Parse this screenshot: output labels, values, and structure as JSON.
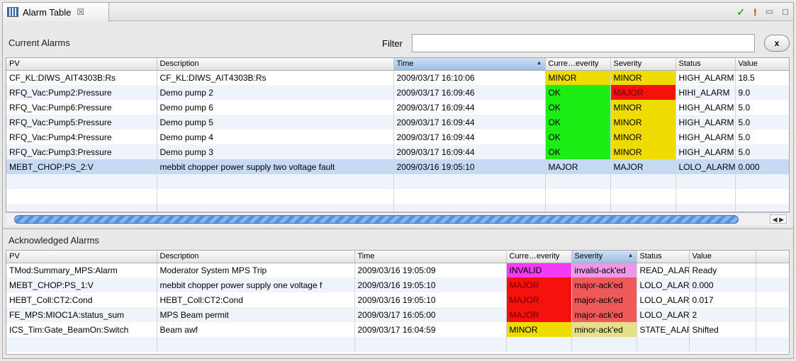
{
  "tab": {
    "title": "Alarm Table",
    "close": "☒"
  },
  "view_tools": {
    "check": "✓",
    "alert": "!",
    "minimize": "▭",
    "maximize": "◻"
  },
  "current": {
    "title": "Current Alarms",
    "filter_label": "Filter",
    "filter_value": "",
    "clear_label": "x",
    "columns": [
      "PV",
      "Description",
      "Time",
      "Curre…everity",
      "Severity",
      "Status",
      "Value"
    ],
    "sorted_column": "Time",
    "rows": [
      {
        "pv": "CF_KL:DIWS_AIT4303B:Rs",
        "description": "CF_KL:DIWS_AIT4303B:Rs",
        "time": "2009/03/17 16:10:06",
        "current_severity": "MINOR",
        "severity": "MINOR",
        "status": "HIGH_ALARM",
        "value": "18.5"
      },
      {
        "pv": "RFQ_Vac:Pump2:Pressure",
        "description": "Demo pump 2",
        "time": "2009/03/17 16:09:46",
        "current_severity": "OK",
        "severity": "MAJOR",
        "status": "HIHI_ALARM",
        "value": "9.0"
      },
      {
        "pv": "RFQ_Vac:Pump6:Pressure",
        "description": "Demo pump 6",
        "time": "2009/03/17 16:09:44",
        "current_severity": "OK",
        "severity": "MINOR",
        "status": "HIGH_ALARM",
        "value": "5.0"
      },
      {
        "pv": "RFQ_Vac:Pump5:Pressure",
        "description": "Demo pump 5",
        "time": "2009/03/17 16:09:44",
        "current_severity": "OK",
        "severity": "MINOR",
        "status": "HIGH_ALARM",
        "value": "5.0"
      },
      {
        "pv": "RFQ_Vac:Pump4:Pressure",
        "description": "Demo pump 4",
        "time": "2009/03/17 16:09:44",
        "current_severity": "OK",
        "severity": "MINOR",
        "status": "HIGH_ALARM",
        "value": "5.0"
      },
      {
        "pv": "RFQ_Vac:Pump3:Pressure",
        "description": "Demo pump 3",
        "time": "2009/03/17 16:09:44",
        "current_severity": "OK",
        "severity": "MINOR",
        "status": "HIGH_ALARM",
        "value": "5.0"
      },
      {
        "pv": "MEBT_CHOP:PS_2:V",
        "description": "mebbit chopper power supply two voltage fault",
        "time": "2009/03/16 19:05:10",
        "current_severity": "MAJOR",
        "severity": "MAJOR",
        "status": "LOLO_ALARM",
        "value": "0.000"
      }
    ],
    "selected_row": 6
  },
  "acknowledged": {
    "title": "Acknowledged Alarms",
    "columns": [
      "PV",
      "Description",
      "Time",
      "Curre…everity",
      "Severity",
      "Status",
      "Value"
    ],
    "sorted_column": "Severity",
    "rows": [
      {
        "pv": "TMod:Summary_MPS:Alarm",
        "description": "Moderator System MPS Trip",
        "time": "2009/03/16 19:05:09",
        "current_severity": "INVALID",
        "severity": "invalid-ack'ed",
        "status": "READ_ALARM",
        "value": "Ready"
      },
      {
        "pv": "MEBT_CHOP:PS_1:V",
        "description": "mebbit chopper power supply one voltage f",
        "time": "2009/03/16 19:05:10",
        "current_severity": "MAJOR",
        "severity": "major-ack'ed",
        "status": "LOLO_ALARM",
        "value": "0.000"
      },
      {
        "pv": "HEBT_Coll:CT2:Cond",
        "description": "HEBT_Coll:CT2:Cond",
        "time": "2009/03/16 19:05:10",
        "current_severity": "MAJOR",
        "severity": "major-ack'ed",
        "status": "LOLO_ALARM",
        "value": "0.017"
      },
      {
        "pv": "FE_MPS:MIOC1A:status_sum",
        "description": "MPS Beam permit",
        "time": "2009/03/17 16:05:00",
        "current_severity": "MAJOR",
        "severity": "major-ack'ed",
        "status": "LOLO_ALARM",
        "value": "2"
      },
      {
        "pv": "ICS_Tim:Gate_BeamOn:Switch",
        "description": "Beam awf",
        "time": "2009/03/17 16:04:59",
        "current_severity": "MINOR",
        "severity": "minor-ack'ed",
        "status": "STATE_ALARM",
        "value": "Shifted"
      }
    ]
  },
  "colors": {
    "minor": "#eedb00",
    "major": "#f5120c",
    "ok": "#1ced14",
    "invalid": "#f23bf2",
    "selection": "#c6daf4",
    "sorted_header": "#9dbde6"
  }
}
